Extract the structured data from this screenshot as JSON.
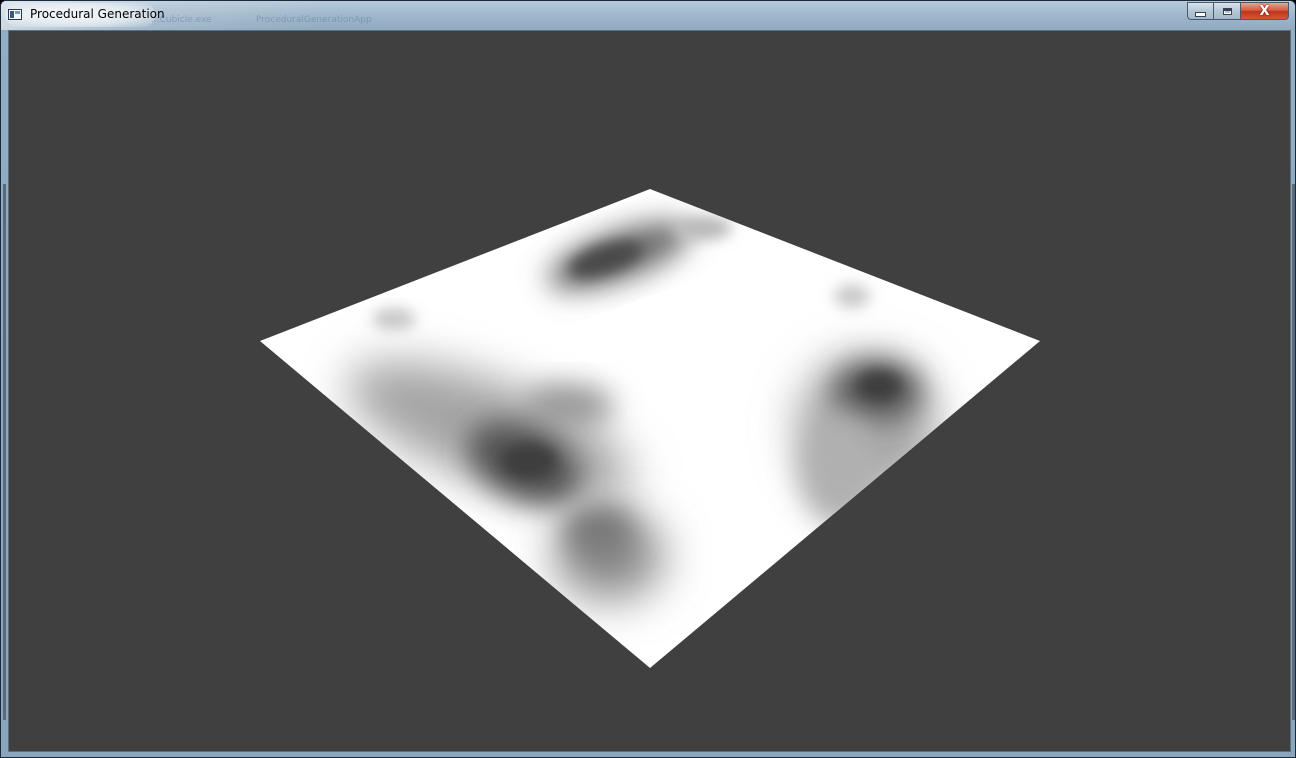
{
  "window": {
    "title": "Procedural Generation",
    "background_title_hints": [
      "...Cubicle.exe",
      "ProceduralGenerationApp"
    ],
    "icon": "application-window-icon",
    "controls": {
      "minimize": "minimize-icon",
      "maximize": "maximize-icon",
      "close_label": "X"
    }
  },
  "viewport": {
    "background_color": "#404040",
    "plane_color": "#ffffff",
    "shadow_color": "#3a3a3a",
    "render": "heightmap-plane"
  }
}
